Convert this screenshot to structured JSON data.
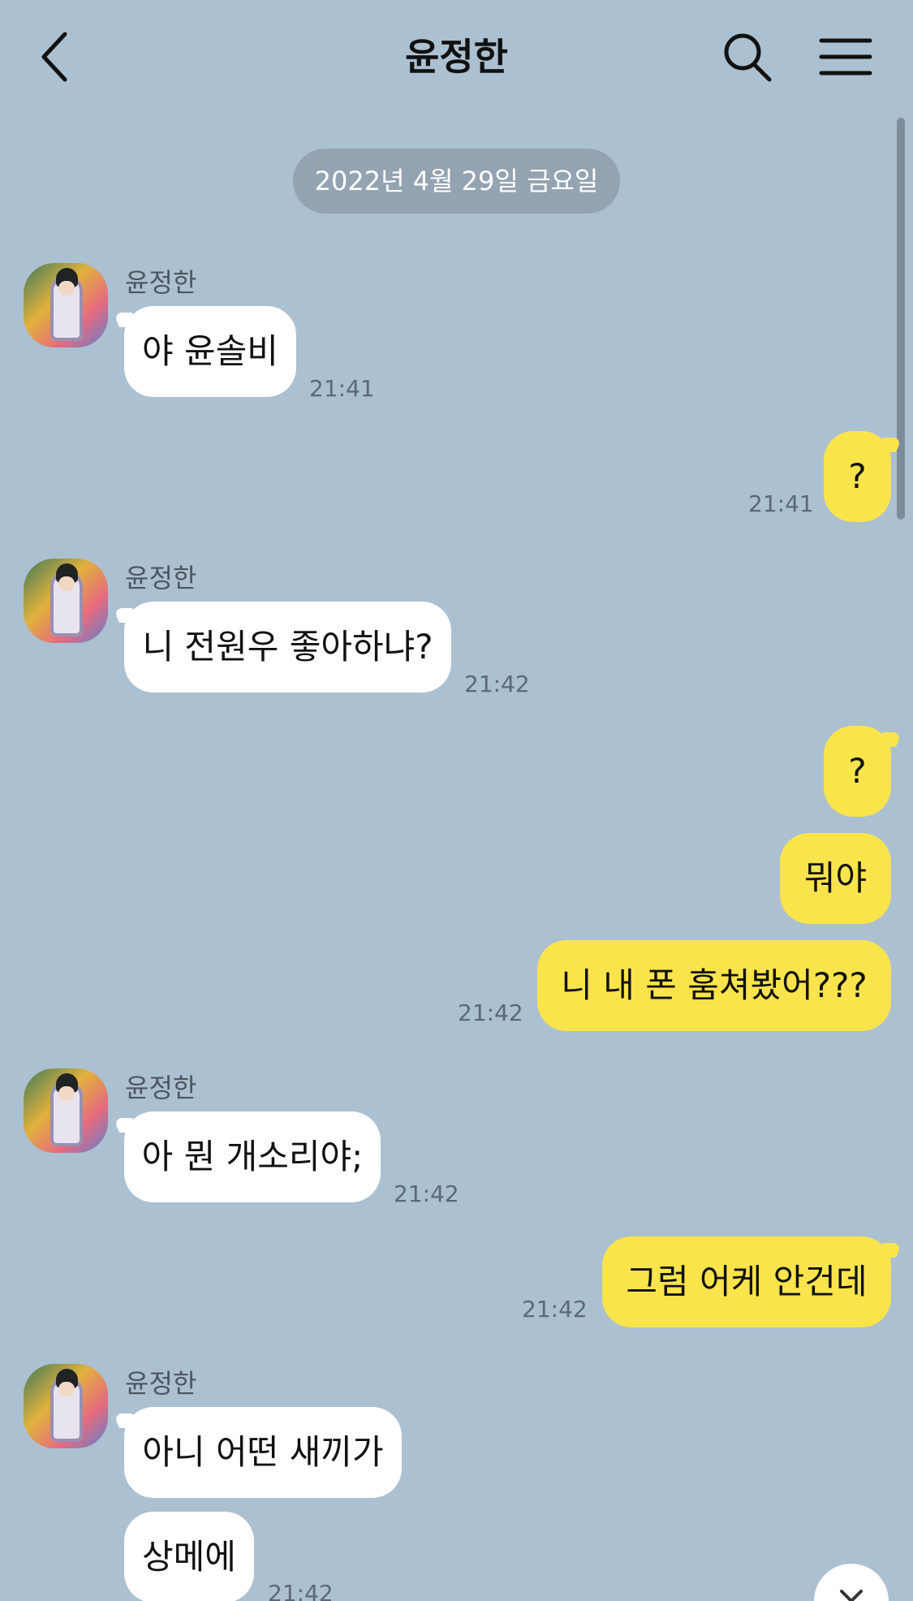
{
  "header": {
    "title": "윤정한",
    "back_icon": "chevron-left-icon",
    "search_icon": "search-icon",
    "menu_icon": "menu-icon"
  },
  "date_badge": "2022년 4월 29일 금요일",
  "colors": {
    "background": "#abc0d1",
    "bubble_in": "#ffffff",
    "bubble_out": "#fae44b",
    "date_badge": "#94a3b1",
    "timestamp": "#5d6875"
  },
  "messages": [
    {
      "side": "left",
      "sender": "윤정한",
      "text": "야 윤솔비",
      "time": "21:41"
    },
    {
      "side": "right",
      "text": "?",
      "time": "21:41"
    },
    {
      "side": "left",
      "sender": "윤정한",
      "text": "니 전원우 좋아하냐?",
      "time": "21:42"
    },
    {
      "side": "right",
      "text": "?",
      "time": ""
    },
    {
      "side": "right",
      "text": "뭐야",
      "time": ""
    },
    {
      "side": "right",
      "text": "니 내 폰 훔쳐봤어???",
      "time": "21:42"
    },
    {
      "side": "left",
      "sender": "윤정한",
      "text": "아 뭔 개소리야;",
      "time": "21:42"
    },
    {
      "side": "right",
      "text": "그럼 어케 안건데",
      "time": "21:42"
    },
    {
      "side": "left",
      "sender": "윤정한",
      "text": "아니 어떤 새끼가",
      "time": ""
    },
    {
      "side": "left",
      "text": "상메에",
      "time": "21:42"
    }
  ],
  "scroll_to_bottom_icon": "chevron-down-icon"
}
